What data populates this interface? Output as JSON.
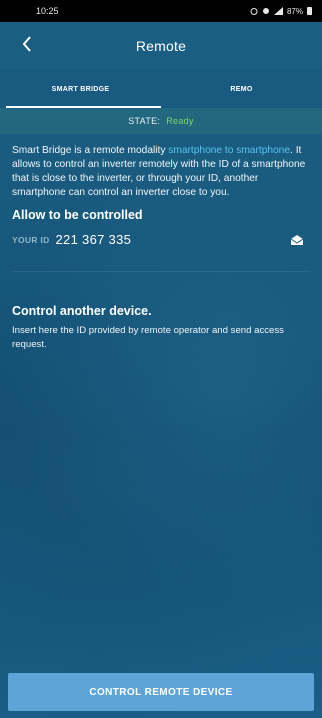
{
  "status_bar": {
    "time": "10:25",
    "battery": "87%"
  },
  "app_bar": {
    "title": "Remote",
    "back_icon": "chevron-left-icon"
  },
  "tabs": [
    {
      "label": "SMART BRIDGE",
      "active": true
    },
    {
      "label": "REMO",
      "active": false
    }
  ],
  "state": {
    "label": "STATE:",
    "value": "Ready",
    "value_color": "#7fd36b"
  },
  "description": {
    "part1": "Smart Bridge is a remote modality ",
    "link": "smartphone to smartphone",
    "part2": ". It allows to control an inverter remotely with the ID of a smartphone that is close to the inverter, or through your ID, another smartphone can control an inverter close to you."
  },
  "allow_section": {
    "title": "Allow to be controlled",
    "id_label": "YOUR ID",
    "id_value": "221 367 335",
    "icon": "mail-icon"
  },
  "control_section": {
    "title": "Control another device.",
    "text": "Insert here the ID provided by remote operator and send access request."
  },
  "cta": {
    "label": "CONTROL REMOTE DEVICE",
    "color": "#5ea4d6"
  }
}
